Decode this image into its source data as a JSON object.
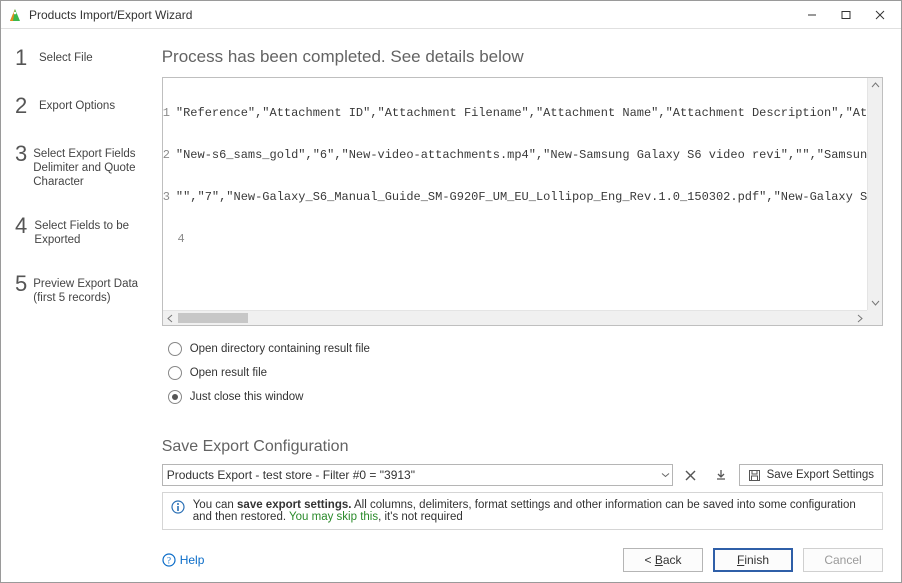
{
  "window": {
    "title": "Products Import/Export Wizard"
  },
  "steps": [
    {
      "num": "1",
      "label": "Select File"
    },
    {
      "num": "2",
      "label": "Export Options"
    },
    {
      "num": "3",
      "label": "Select Export Fields Delimiter and Quote Character"
    },
    {
      "num": "4",
      "label": "Select Fields to be Exported"
    },
    {
      "num": "5",
      "label": "Preview Export Data (first 5 records)"
    }
  ],
  "heading": "Process has been completed. See details below",
  "code_lines": [
    "\"Reference\",\"Attachment ID\",\"Attachment Filename\",\"Attachment Name\",\"Attachment Description\",\"At",
    "\"New-s6_sams_gold\",\"6\",\"New-video-attachments.mp4\",\"New-Samsung Galaxy S6 video revi\",\"\",\"Samsun",
    "\"\",\"7\",\"New-Galaxy_S6_Manual_Guide_SM-G920F_UM_EU_Lollipop_Eng_Rev.1.0_150302.pdf\",\"New-Galaxy S",
    ""
  ],
  "radios": {
    "open_dir": "Open directory containing result file",
    "open_file": "Open result file",
    "just_close": "Just close this window",
    "selected": "just_close"
  },
  "save_config": {
    "heading": "Save Export Configuration",
    "value": "Products Export - test store - Filter #0 = \"3913\"",
    "save_btn": "Save Export Settings"
  },
  "info": {
    "pre": "You can ",
    "bold": "save export settings.",
    "mid": " All columns, delimiters, format settings and other information can be saved into some configuration and then restored. ",
    "green": "You may skip this",
    "post": ", it's not required"
  },
  "footer": {
    "help": "Help",
    "back": "< Back",
    "finish": "Finish",
    "cancel": "Cancel"
  }
}
